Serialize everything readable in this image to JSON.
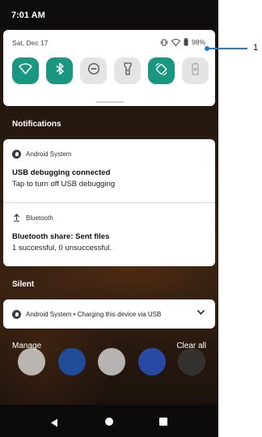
{
  "status_bar": {
    "time": "7:01 AM"
  },
  "quick_settings": {
    "date": "Sat, Dec 17",
    "battery_percent": "98%",
    "tiles": [
      {
        "name": "wifi-tile",
        "icon": "wifi-icon",
        "active": true
      },
      {
        "name": "bluetooth-tile",
        "icon": "bluetooth-icon",
        "active": true
      },
      {
        "name": "do-not-disturb-tile",
        "icon": "do-not-disturb-icon",
        "active": false
      },
      {
        "name": "flashlight-tile",
        "icon": "flashlight-icon",
        "active": false
      },
      {
        "name": "auto-rotate-tile",
        "icon": "auto-rotate-icon",
        "active": true
      },
      {
        "name": "battery-saver-tile",
        "icon": "battery-saver-icon",
        "active": false
      }
    ],
    "colors": {
      "active_tile": "#1a9780",
      "inactive_tile": "#e4e4e4"
    }
  },
  "sections": {
    "notifications": "Notifications",
    "silent": "Silent"
  },
  "notifications": [
    {
      "app": "Android System",
      "title": "USB debugging connected",
      "body": "Tap to turn off USB debugging",
      "icon": "android-system-icon"
    },
    {
      "app": "Bluetooth",
      "title": "Bluetooth share: Sent files",
      "body": "1 successful, 0 unsuccessful.",
      "icon": "upload-arrow-icon"
    }
  ],
  "silent_notification": {
    "app": "Android System",
    "summary": "Android System • Charging this device via USB"
  },
  "actions": {
    "manage": "Manage",
    "clear_all": "Clear all"
  },
  "callout": {
    "number": "1",
    "color": "#1f7fcf"
  }
}
